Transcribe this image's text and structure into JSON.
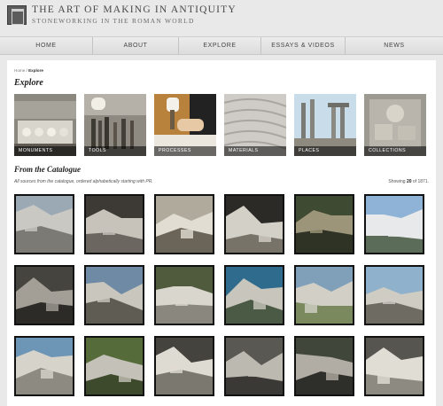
{
  "site": {
    "title": "THE ART OF MAKING IN ANTIQUITY",
    "subtitle": "STONEWORKING IN THE ROMAN WORLD"
  },
  "nav": [
    {
      "label": "HOME"
    },
    {
      "label": "ABOUT"
    },
    {
      "label": "EXPLORE"
    },
    {
      "label": "ESSAYS & VIDEOS"
    },
    {
      "label": "NEWS"
    }
  ],
  "breadcrumb": {
    "home": "Home",
    "separator": " / ",
    "current": "Explore"
  },
  "explore_heading": "Explore",
  "categories": [
    {
      "label": "MONUMENTS",
      "icon": "monuments-image"
    },
    {
      "label": "TOOLS",
      "icon": "tools-image"
    },
    {
      "label": "PROCESSES",
      "icon": "processes-image"
    },
    {
      "label": "MATERIALS",
      "icon": "materials-image"
    },
    {
      "label": "PLACES",
      "icon": "places-image"
    },
    {
      "label": "COLLECTIONS",
      "icon": "collections-image"
    }
  ],
  "catalogue": {
    "heading": "From the Catalogue",
    "description": "All sources from the catalogue, ordered alphabetically starting with PR.",
    "showing_prefix": "Showing",
    "showing_count": "20",
    "showing_of": "of",
    "showing_total": "1871",
    "showing_suffix": "."
  },
  "thumbnails": [
    {
      "icon": "quarry-photo"
    },
    {
      "icon": "quarry-photo"
    },
    {
      "icon": "quarry-photo"
    },
    {
      "icon": "quarry-photo"
    },
    {
      "icon": "quarry-photo"
    },
    {
      "icon": "quarry-photo"
    },
    {
      "icon": "quarry-photo"
    },
    {
      "icon": "quarry-photo"
    },
    {
      "icon": "quarry-photo"
    },
    {
      "icon": "quarry-photo"
    },
    {
      "icon": "quarry-photo"
    },
    {
      "icon": "quarry-photo"
    },
    {
      "icon": "quarry-photo"
    },
    {
      "icon": "quarry-photo"
    },
    {
      "icon": "quarry-photo"
    },
    {
      "icon": "quarry-photo"
    },
    {
      "icon": "quarry-photo"
    },
    {
      "icon": "quarry-photo"
    }
  ]
}
